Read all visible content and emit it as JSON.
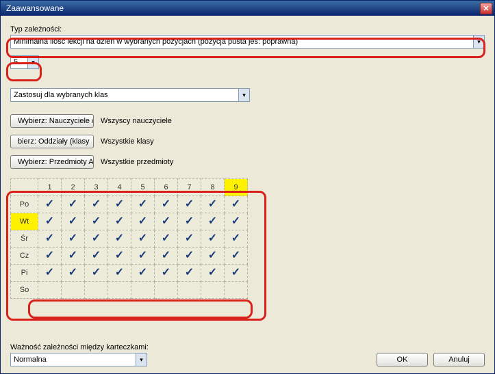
{
  "title": "Zaawansowane",
  "dependency_label": "Typ zależności:",
  "dependency_value": "Minimalna ilość lekcji na dzień w wybranych pozycjach (pozycja pusta jes: poprawna)",
  "count_value": "5",
  "apply_label": "Zastosuj dla wybranych klas",
  "selectors": [
    {
      "button": "Wybierz: Nauczyciele /",
      "text": "Wszyscy nauczyciele"
    },
    {
      "button": "bierz: Oddziały (klasy",
      "text": "Wszystkie klasy"
    },
    {
      "button": "Wybierz: Przedmioty A",
      "text": "Wszystkie przedmioty"
    }
  ],
  "grid": {
    "cols": [
      "1",
      "2",
      "3",
      "4",
      "5",
      "6",
      "7",
      "8",
      "9"
    ],
    "highlight_col_index": 8,
    "rows": [
      {
        "label": "Po",
        "highlight": false,
        "cells": [
          true,
          true,
          true,
          true,
          true,
          true,
          true,
          true,
          true
        ]
      },
      {
        "label": "Wt",
        "highlight": true,
        "cells": [
          true,
          true,
          true,
          true,
          true,
          true,
          true,
          true,
          true
        ]
      },
      {
        "label": "Śr",
        "highlight": false,
        "cells": [
          true,
          true,
          true,
          true,
          true,
          true,
          true,
          true,
          true
        ]
      },
      {
        "label": "Cz",
        "highlight": false,
        "cells": [
          true,
          true,
          true,
          true,
          true,
          true,
          true,
          true,
          true
        ]
      },
      {
        "label": "Pi",
        "highlight": false,
        "cells": [
          true,
          true,
          true,
          true,
          true,
          true,
          true,
          true,
          true
        ]
      },
      {
        "label": "So",
        "highlight": false,
        "cells": [
          false,
          false,
          false,
          false,
          false,
          false,
          false,
          false,
          false
        ]
      }
    ]
  },
  "importance_label": "Ważność zależności między karteczkami:",
  "importance_value": "Normalna",
  "ok_label": "OK",
  "cancel_label": "Anuluj"
}
